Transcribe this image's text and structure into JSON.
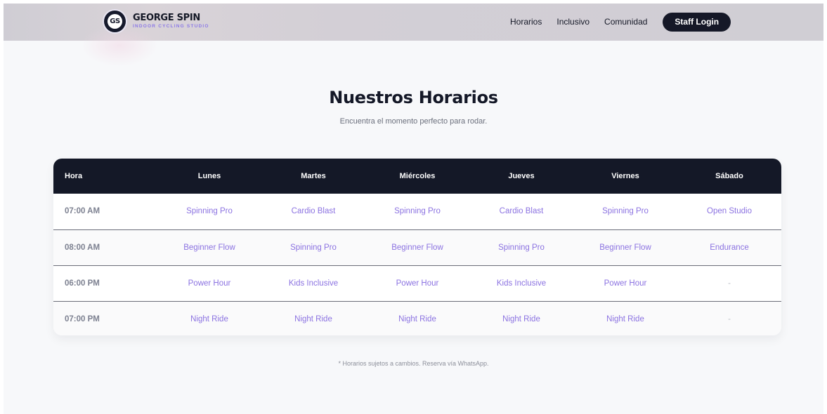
{
  "brand": {
    "logo_text": "GS",
    "name": "GEORGE SPIN",
    "tagline": "INDOOR CYCLING STUDIO"
  },
  "nav": {
    "links": [
      "Horarios",
      "Inclusivo",
      "Comunidad"
    ],
    "staff_login": "Staff Login"
  },
  "schedule": {
    "title": "Nuestros Horarios",
    "subtitle": "Encuentra el momento perfecto para rodar.",
    "headers": [
      "Hora",
      "Lunes",
      "Martes",
      "Miércoles",
      "Jueves",
      "Viernes",
      "Sábado"
    ],
    "rows": [
      [
        "07:00 AM",
        "Spinning Pro",
        "Cardio Blast",
        "Spinning Pro",
        "Cardio Blast",
        "Spinning Pro",
        "Open Studio"
      ],
      [
        "08:00 AM",
        "Beginner Flow",
        "Spinning Pro",
        "Beginner Flow",
        "Spinning Pro",
        "Beginner Flow",
        "Endurance"
      ],
      [
        "06:00 PM",
        "Power Hour",
        "Kids Inclusive",
        "Power Hour",
        "Kids Inclusive",
        "Power Hour",
        "-"
      ],
      [
        "07:00 PM",
        "Night Ride",
        "Night Ride",
        "Night Ride",
        "Night Ride",
        "Night Ride",
        "-"
      ]
    ],
    "note": "* Horarios sujetos a cambios. Reserva vía WhatsApp."
  },
  "colors": {
    "dark": "#141827",
    "accent": "#8b72e1",
    "background": "#f7f8fa"
  }
}
